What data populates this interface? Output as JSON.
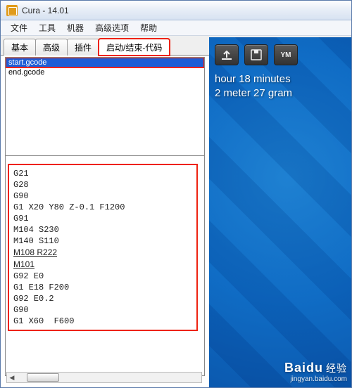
{
  "window": {
    "title": "Cura - 14.01"
  },
  "menubar": {
    "items": [
      "文件",
      "工具",
      "机器",
      "高级选项",
      "帮助"
    ]
  },
  "tabs": {
    "items": [
      "基本",
      "高级",
      "插件",
      "启动/结束-代码"
    ],
    "active": 3
  },
  "filelist": {
    "items": [
      "start.gcode",
      "end.gcode"
    ],
    "selected": 0
  },
  "gcode": {
    "lines": [
      {
        "t": "G21"
      },
      {
        "t": "G28"
      },
      {
        "t": "G90"
      },
      {
        "t": "G1 X20 Y80 Z-0.1 F1200"
      },
      {
        "t": "G91"
      },
      {
        "t": "M104 S230"
      },
      {
        "t": "M140 S110"
      },
      {
        "t": "M108 R222",
        "u": true
      },
      {
        "t": "M101",
        "u": true
      },
      {
        "t": "G92 E0"
      },
      {
        "t": "G1 E18 F200"
      },
      {
        "t": "G92 E0.2"
      },
      {
        "t": "G90"
      },
      {
        "t": "G1 X60  F600"
      }
    ]
  },
  "viewport": {
    "stats_line1": "hour 18 minutes",
    "stats_line2": "2 meter 27 gram",
    "toolbar_icons": [
      "load-icon",
      "save-icon",
      "ym-icon"
    ],
    "ym_label": "YM"
  },
  "watermark": {
    "brand": "Baidu",
    "cn": "经验",
    "url": "jingyan.baidu.com"
  }
}
